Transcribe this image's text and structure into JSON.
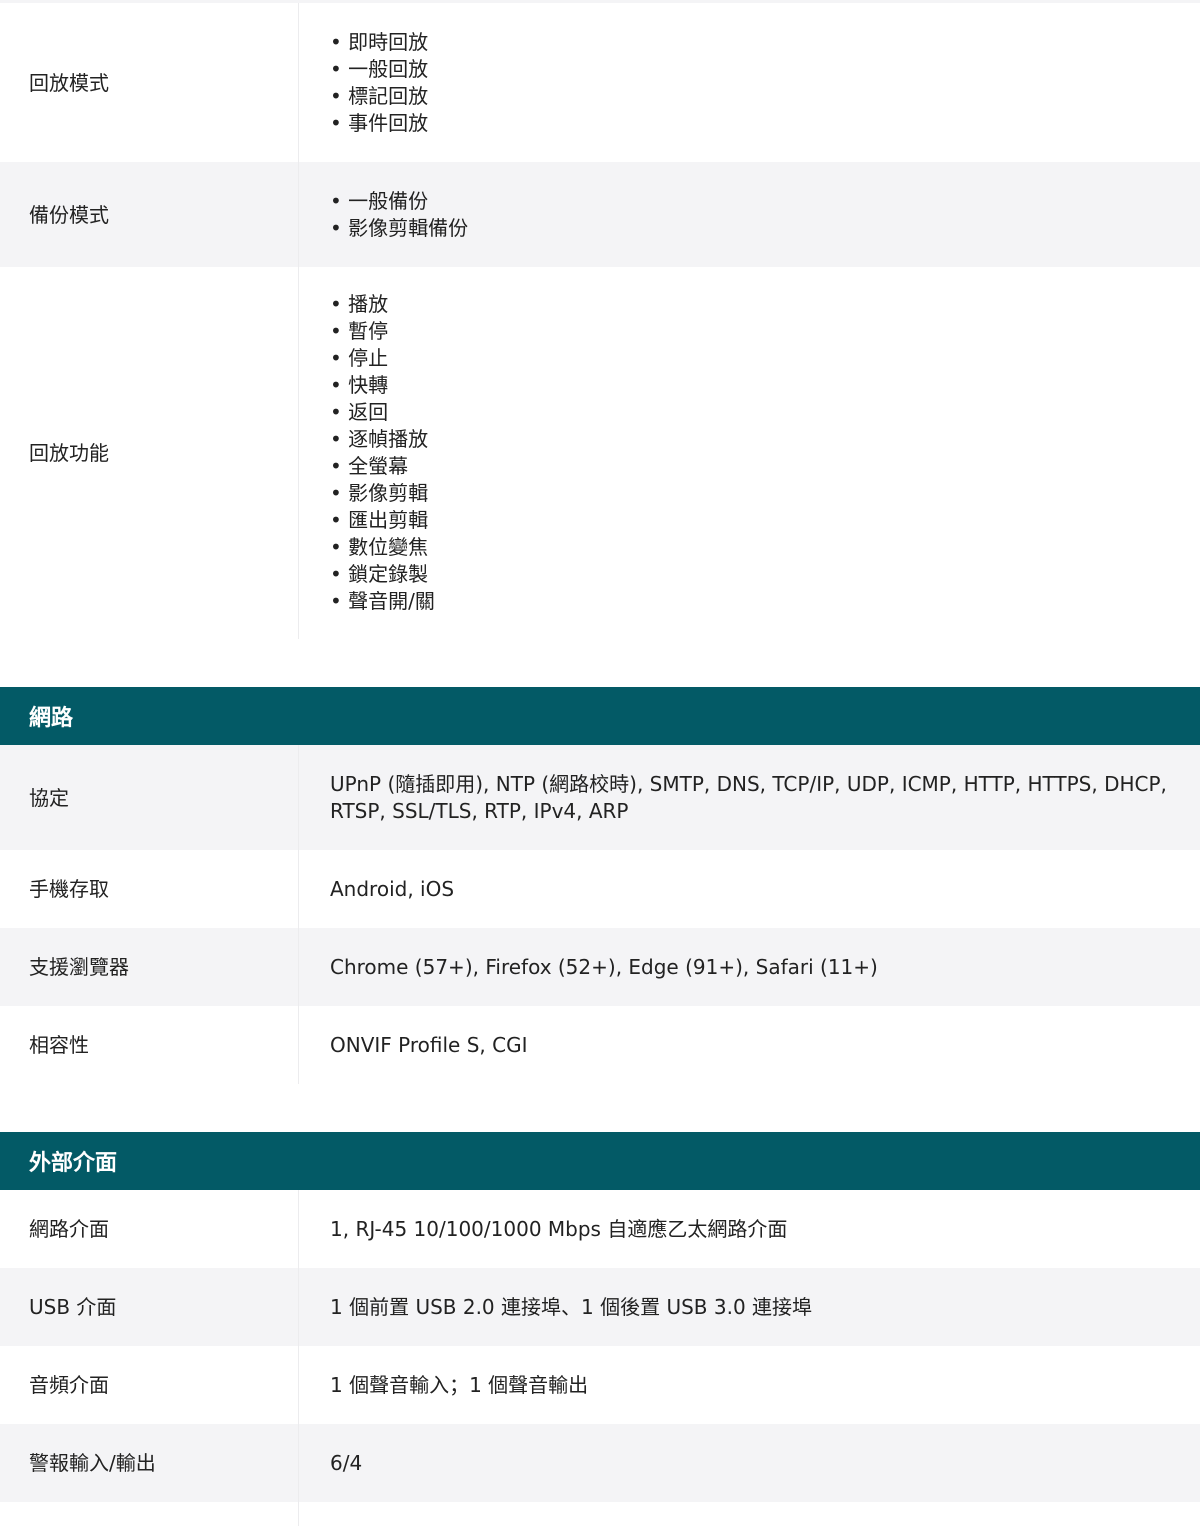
{
  "playback": {
    "rows": [
      {
        "label": "回放模式",
        "items": [
          "即時回放",
          "一般回放",
          "標記回放",
          "事件回放"
        ]
      },
      {
        "label": "備份模式",
        "items": [
          "一般備份",
          "影像剪輯備份"
        ]
      },
      {
        "label": "回放功能",
        "items": [
          "播放",
          "暫停",
          "停止",
          "快轉",
          "返回",
          "逐幀播放",
          "全螢幕",
          "影像剪輯",
          "匯出剪輯",
          "數位變焦",
          "鎖定錄製",
          "聲音開/關"
        ]
      }
    ]
  },
  "network": {
    "title": "網路",
    "rows": [
      {
        "label": "協定",
        "value": "UPnP (隨插即用), NTP (網路校時), SMTP, DNS, TCP/IP, UDP, ICMP, HTTP, HTTPS, DHCP, RTSP, SSL/TLS, RTP, IPv4, ARP"
      },
      {
        "label": "手機存取",
        "value": "Android, iOS"
      },
      {
        "label": "支援瀏覽器",
        "value": "Chrome (57+), Firefox (52+), Edge (91+), Safari (11+)"
      },
      {
        "label": "相容性",
        "value": "ONVIF Profile S, CGI"
      }
    ]
  },
  "external_interface": {
    "title": "外部介面",
    "rows": [
      {
        "label": "網路介面",
        "value": "1, RJ-45 10/100/1000 Mbps 自適應乙太網路介面"
      },
      {
        "label": "USB 介面",
        "value": "1 個前置 USB 2.0 連接埠、1 個後置 USB 3.0 連接埠"
      },
      {
        "label": "音頻介面",
        "value": "1 個聲音輸入；1 個聲音輸出"
      },
      {
        "label": "警報輸入/輸出",
        "value": "6/4"
      }
    ]
  }
}
